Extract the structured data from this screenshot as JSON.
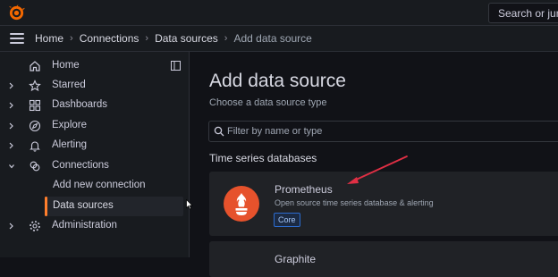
{
  "search": {
    "placeholder": "Search or jump to..."
  },
  "breadcrumb": [
    "Home",
    "Connections",
    "Data sources",
    "Add data source"
  ],
  "sidebar": {
    "items": [
      {
        "label": "Home",
        "icon": "home-icon"
      },
      {
        "label": "Starred",
        "icon": "star-icon"
      },
      {
        "label": "Dashboards",
        "icon": "dashboards-icon"
      },
      {
        "label": "Explore",
        "icon": "explore-icon"
      },
      {
        "label": "Alerting",
        "icon": "bell-icon"
      },
      {
        "label": "Connections",
        "icon": "connections-icon"
      },
      {
        "label": "Add new connection"
      },
      {
        "label": "Data sources"
      },
      {
        "label": "Administration",
        "icon": "gear-icon"
      }
    ]
  },
  "main": {
    "title": "Add data source",
    "subtitle": "Choose a data source type",
    "filter_placeholder": "Filter by name or type",
    "section": "Time series databases",
    "cards": [
      {
        "name": "Prometheus",
        "description": "Open source time series database & alerting",
        "badge": "Core"
      },
      {
        "name": "Graphite"
      }
    ]
  },
  "colors": {
    "accent": "#ff7e2c",
    "background": "#111217",
    "panel": "#181b1f",
    "arrow": "#e02f44"
  }
}
